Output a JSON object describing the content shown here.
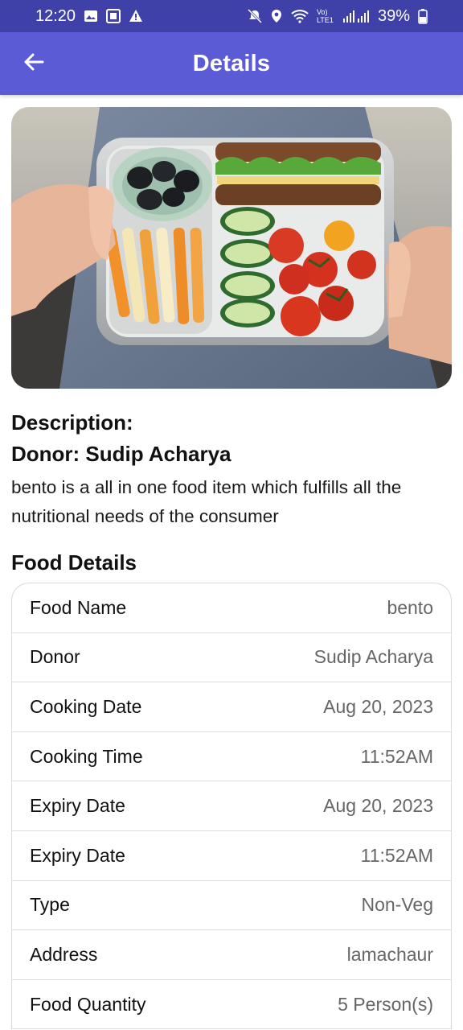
{
  "status_bar": {
    "time": "12:20",
    "battery_percent": "39%",
    "network": "Vo) LTE1",
    "icons": [
      "image-icon",
      "sim-icon",
      "warning-icon",
      "mute-icon",
      "location-icon",
      "wifi-icon",
      "signal-icon",
      "battery-icon"
    ]
  },
  "app_bar": {
    "title": "Details",
    "back_icon": "arrow-left-icon"
  },
  "hero_image": {
    "subject": "bento lunch box"
  },
  "description": {
    "heading": "Description:",
    "donor_line": "Donor: Sudip Acharya",
    "body": "bento is a all in one food item which fulfills all the nutritional needs of the consumer"
  },
  "food_details": {
    "title": "Food Details",
    "rows": [
      {
        "label": "Food Name",
        "value": "bento"
      },
      {
        "label": "Donor",
        "value": "Sudip Acharya"
      },
      {
        "label": "Cooking Date",
        "value": "Aug 20, 2023"
      },
      {
        "label": "Cooking Time",
        "value": "11:52AM"
      },
      {
        "label": "Expiry Date",
        "value": "Aug 20, 2023"
      },
      {
        "label": "Expiry Date",
        "value": "11:52AM"
      },
      {
        "label": "Type",
        "value": "Non-Veg"
      },
      {
        "label": "Address",
        "value": "lamachaur"
      },
      {
        "label": "Food Quantity",
        "value": "5 Person(s)"
      }
    ]
  },
  "colors": {
    "status_bar": "#3f41a8",
    "app_bar": "#5b5bd6",
    "value_text": "#666666"
  }
}
